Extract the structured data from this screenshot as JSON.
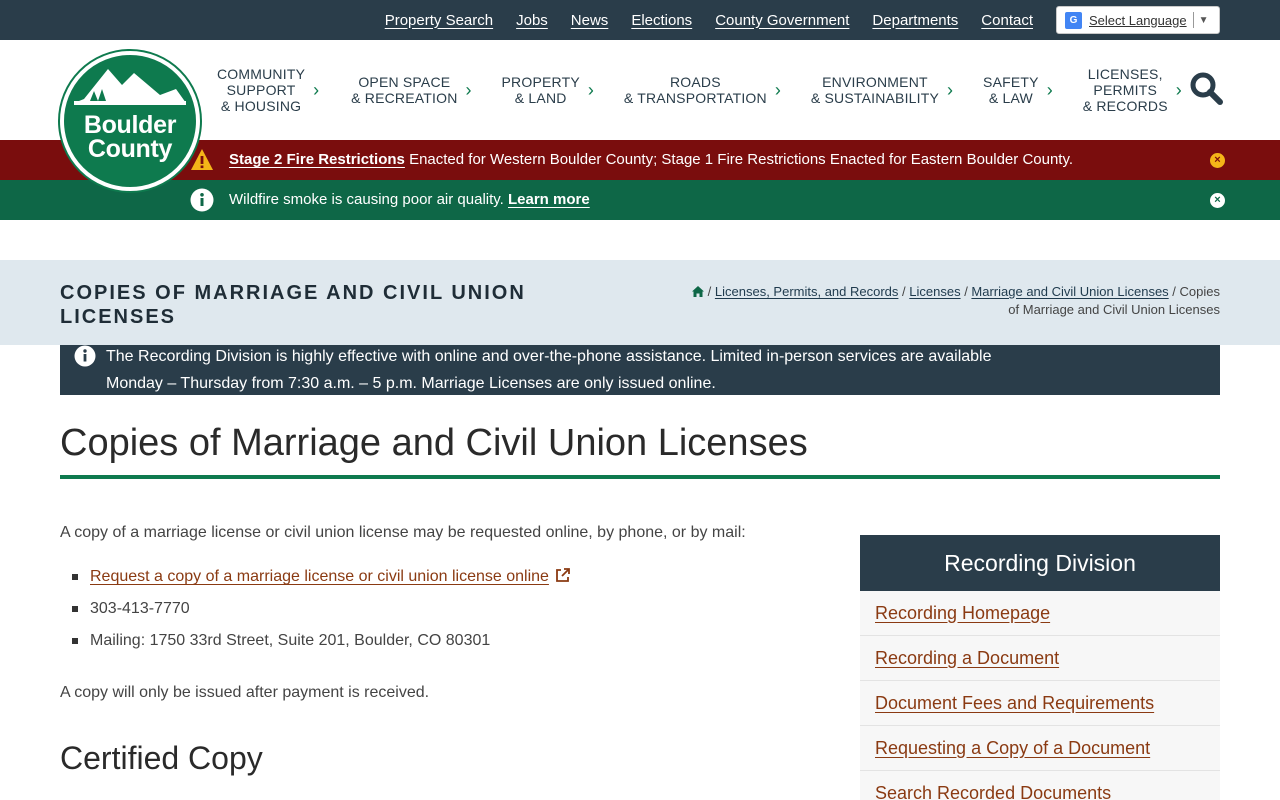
{
  "utility": {
    "links": [
      "Property Search",
      "Jobs",
      "News",
      "Elections",
      "County Government",
      "Departments",
      "Contact"
    ],
    "language": "Select Language"
  },
  "logo": {
    "line1": "Boulder",
    "line2": "County"
  },
  "nav": {
    "items": [
      {
        "lines": [
          "COMMUNITY",
          "SUPPORT",
          "& HOUSING"
        ]
      },
      {
        "lines": [
          "OPEN SPACE",
          "& RECREATION"
        ]
      },
      {
        "lines": [
          "PROPERTY",
          "& LAND"
        ]
      },
      {
        "lines": [
          "ROADS",
          "& TRANSPORTATION"
        ]
      },
      {
        "lines": [
          "ENVIRONMENT",
          "& SUSTAINABILITY"
        ]
      },
      {
        "lines": [
          "SAFETY",
          "& LAW"
        ]
      },
      {
        "lines": [
          "LICENSES,",
          "PERMITS",
          "& RECORDS"
        ]
      }
    ],
    "chevron": "›"
  },
  "alerts": {
    "fire": {
      "link": "Stage 2 Fire Restrictions",
      "text": " Enacted for Western Boulder County; Stage 1 Fire Restrictions Enacted for Eastern Boulder County."
    },
    "smoke": {
      "text": "Wildfire smoke is causing poor air quality. ",
      "link": "Learn more"
    },
    "close_glyph": "×"
  },
  "title_band": {
    "title": "Copies of Marriage and Civil Union Licenses",
    "breadcrumb": {
      "items": [
        "Licenses, Permits, and Records",
        "Licenses",
        "Marriage and Civil Union Licenses"
      ],
      "separator": " / ",
      "current": "Copies of Marriage and Civil Union Licenses"
    }
  },
  "info_banner": {
    "text": "The Recording Division is highly effective with online and over-the-phone assistance. Limited in-person services are available Monday – Thursday from 7:30 a.m. – 5 p.m. Marriage Licenses are only issued online."
  },
  "content": {
    "heading": "Copies of Marriage and Civil Union Licenses",
    "intro": "A copy of a marriage license or civil union license may be requested online, by phone, or by mail:",
    "request_link": "Request a copy of a marriage license or civil union license online",
    "phone": "303-413-7770",
    "mailing": "Mailing: 1750 33rd Street, Suite 201, Boulder, CO 80301",
    "note": "A copy will only be issued after payment is received.",
    "sub_heading": "Certified Copy"
  },
  "sidebar": {
    "title": "Recording Division",
    "items": [
      "Recording Homepage",
      "Recording a Document",
      "Document Fees and Requirements",
      "Requesting a Copy of a Document",
      "Search Recorded Documents"
    ]
  },
  "colors": {
    "dark_slate": "#2a3d4a",
    "brand_green": "#0e7a4e",
    "alert_red": "#7a0d0d",
    "alert_green": "#0e6747",
    "warning_yellow": "#f5b518",
    "link_rust": "#8a3a12",
    "band_blue": "#dfe8ee"
  },
  "icons": {
    "warning": "warning-triangle-icon",
    "info": "info-circle-icon",
    "close": "close-circle-icon",
    "search": "search-icon",
    "home": "home-icon",
    "external": "external-link-icon",
    "translate": "translate-icon"
  }
}
